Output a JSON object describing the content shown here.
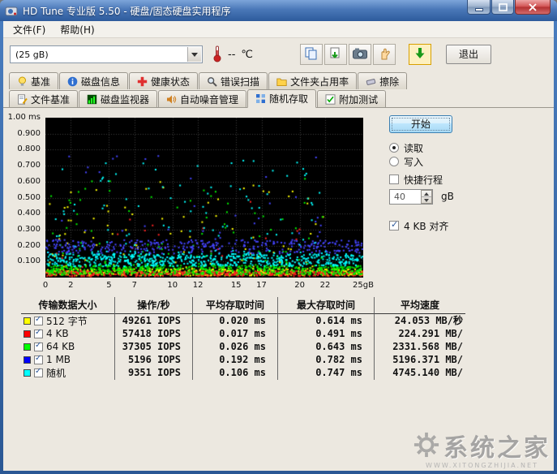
{
  "window": {
    "title": "HD Tune 专业版 5.50 - 硬盘/固态硬盘实用程序"
  },
  "menu": {
    "file": "文件(F)",
    "help": "帮助(H)"
  },
  "toolbar": {
    "drive_select": "(25 gB)",
    "temp_value": "--",
    "temp_unit": "℃",
    "exit_label": "退出"
  },
  "tabs": {
    "row1": [
      {
        "id": "benchmark",
        "label": "基准",
        "icon": "lightbulb-icon",
        "active": false
      },
      {
        "id": "disk-info",
        "label": "磁盘信息",
        "icon": "info-icon",
        "active": false
      },
      {
        "id": "health",
        "label": "健康状态",
        "icon": "health-cross-icon",
        "active": false
      },
      {
        "id": "error-scan",
        "label": "错误扫描",
        "icon": "magnifier-icon",
        "active": false
      },
      {
        "id": "folder-usage",
        "label": "文件夹占用率",
        "icon": "folder-icon",
        "active": false
      },
      {
        "id": "erase",
        "label": "擦除",
        "icon": "eraser-icon",
        "active": false
      }
    ],
    "row2": [
      {
        "id": "file-benchmark",
        "label": "文件基准",
        "icon": "file-pencil-icon",
        "active": false
      },
      {
        "id": "disk-monitor",
        "label": "磁盘监视器",
        "icon": "monitor-chart-icon",
        "active": false
      },
      {
        "id": "aam",
        "label": "自动噪音管理",
        "icon": "speaker-icon",
        "active": false
      },
      {
        "id": "random-access",
        "label": "随机存取",
        "icon": "grid-random-icon",
        "active": true
      },
      {
        "id": "extra-tests",
        "label": "附加测试",
        "icon": "checklist-icon",
        "active": false
      }
    ]
  },
  "controls": {
    "start_label": "开始",
    "read_label": "读取",
    "write_label": "写入",
    "read_selected": true,
    "short_stroke_label": "快捷行程",
    "short_stroke_checked": false,
    "short_stroke_value": "40",
    "short_stroke_unit": "gB",
    "align_label": "4 KB 对齐",
    "align_checked": true
  },
  "chart_data": {
    "type": "scatter",
    "x_unit": "gB",
    "y_unit": "ms",
    "xlim": [
      0,
      25
    ],
    "ylim": [
      0,
      1.0
    ],
    "x_ticks": [
      "0",
      "2",
      "5",
      "7",
      "10",
      "12",
      "15",
      "17",
      "20",
      "22",
      "25gB"
    ],
    "y_ticks": [
      "1.00",
      "0.900",
      "0.800",
      "0.700",
      "0.600",
      "0.500",
      "0.400",
      "0.300",
      "0.200",
      "0.100"
    ],
    "grid": true,
    "background": "#000000",
    "legend": false,
    "series": [
      {
        "name": "512 字节",
        "color": "#ffff00",
        "avg_ms": 0.02,
        "max_ms": 0.614,
        "count": 550,
        "band": [
          0.012,
          0.055
        ],
        "outlier_ratio": 0.16,
        "outlier_max": 0.6,
        "seed": 11
      },
      {
        "name": "4 KB",
        "color": "#ff2222",
        "avg_ms": 0.017,
        "max_ms": 0.491,
        "count": 460,
        "band": [
          0.008,
          0.04
        ],
        "outlier_ratio": 0.05,
        "outlier_max": 0.48,
        "seed": 22
      },
      {
        "name": "64 KB",
        "color": "#00ee00",
        "avg_ms": 0.026,
        "max_ms": 0.643,
        "count": 650,
        "band": [
          0.018,
          0.075
        ],
        "outlier_ratio": 0.14,
        "outlier_max": 0.64,
        "seed": 33
      },
      {
        "name": "1 MB",
        "color": "#4444ff",
        "avg_ms": 0.192,
        "max_ms": 0.782,
        "count": 380,
        "band": [
          0.15,
          0.235
        ],
        "outlier_ratio": 0.1,
        "outlier_max": 0.78,
        "seed": 44
      },
      {
        "name": "随机",
        "color": "#00ffff",
        "avg_ms": 0.106,
        "max_ms": 0.747,
        "count": 720,
        "band": [
          0.07,
          0.148
        ],
        "outlier_ratio": 0.15,
        "outlier_max": 0.74,
        "seed": 55
      }
    ]
  },
  "table": {
    "headers": [
      "传输数据大小",
      "操作/秒",
      "平均存取时间",
      "最大存取时间",
      "平均速度"
    ],
    "rows": [
      {
        "checked": true,
        "color": "#ffff00",
        "label": "512 字节",
        "ops": "49261 IOPS",
        "avg_time": "0.020 ms",
        "max_time": "0.614 ms",
        "avg_speed": "24.053 MB/秒"
      },
      {
        "checked": true,
        "color": "#ff0000",
        "label": "4 KB",
        "ops": "57418 IOPS",
        "avg_time": "0.017 ms",
        "max_time": "0.491 ms",
        "avg_speed": "224.291 MB/"
      },
      {
        "checked": true,
        "color": "#00ff00",
        "label": "64 KB",
        "ops": "37305 IOPS",
        "avg_time": "0.026 ms",
        "max_time": "0.643 ms",
        "avg_speed": "2331.568 MB/"
      },
      {
        "checked": true,
        "color": "#0000ff",
        "label": "1 MB",
        "ops": "5196 IOPS",
        "avg_time": "0.192 ms",
        "max_time": "0.782 ms",
        "avg_speed": "5196.371 MB/"
      },
      {
        "checked": true,
        "color": "#00ffff",
        "label": "随机",
        "ops": "9351 IOPS",
        "avg_time": "0.106 ms",
        "max_time": "0.747 ms",
        "avg_speed": "4745.140 MB/"
      }
    ]
  },
  "watermark": {
    "text": "系统之家",
    "subtext": "WWW.XITONGZHIJIA.NET"
  }
}
